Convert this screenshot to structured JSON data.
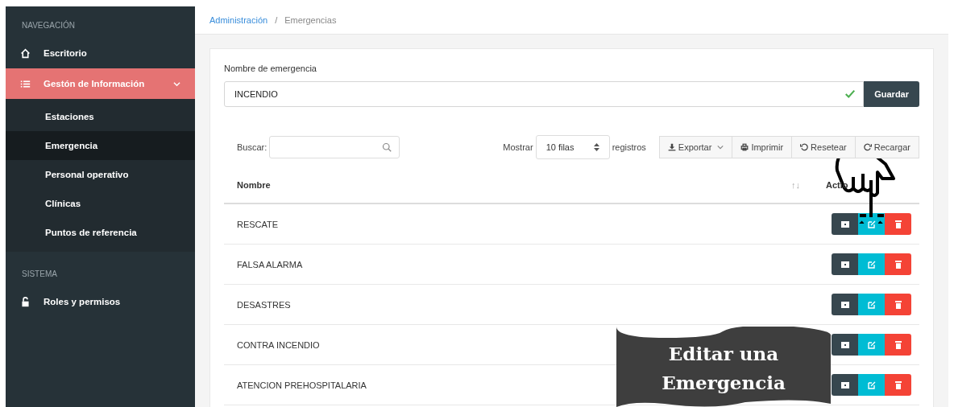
{
  "sidebar": {
    "sections": [
      {
        "heading": "NAVEGACIÓN",
        "items": [
          {
            "label": "Escritorio",
            "selected": false
          },
          {
            "label": "Gestón de Información",
            "selected": true,
            "expanded": true,
            "children": [
              {
                "label": "Estaciones",
                "selected": false
              },
              {
                "label": "Emergencia",
                "selected": true
              },
              {
                "label": "Personal operativo",
                "selected": false
              },
              {
                "label": "Clínicas",
                "selected": false
              },
              {
                "label": "Puntos de referencia",
                "selected": false
              }
            ]
          }
        ]
      },
      {
        "heading": "SISTEMA",
        "items": [
          {
            "label": "Roles y permisos",
            "selected": false
          }
        ]
      }
    ]
  },
  "breadcrumb": [
    {
      "label": "Administración",
      "kind": "link"
    },
    {
      "label": "/",
      "kind": "separator"
    },
    {
      "label": "Emergencias",
      "kind": "current"
    }
  ],
  "form": {
    "label": "Nombre de emergencia",
    "value": "INCENDIO",
    "valid": true,
    "button": "Guardar"
  },
  "toolbar": {
    "search_label": "Buscar:",
    "show_label": "Mostrar",
    "page_size": "10 filas",
    "records_label": "registros",
    "buttons": [
      {
        "label": "Exportar",
        "dropdown": true
      },
      {
        "label": "Imprimir",
        "dropdown": false
      },
      {
        "label": "Resetear",
        "dropdown": false
      },
      {
        "label": "Recargar",
        "dropdown": false
      }
    ]
  },
  "table": {
    "columns": [
      {
        "label": "Nombre",
        "sort": "↑↓"
      },
      {
        "label": "Actio"
      }
    ],
    "rows": [
      {
        "name": "RESCATE"
      },
      {
        "name": "FALSA ALARMA"
      },
      {
        "name": "DESASTRES"
      },
      {
        "name": "CONTRA INCENDIO"
      },
      {
        "name": "ATENCION PREHOSPITALARIA"
      }
    ]
  },
  "callout": {
    "lines": [
      "Editar una",
      "Emergencia"
    ]
  }
}
